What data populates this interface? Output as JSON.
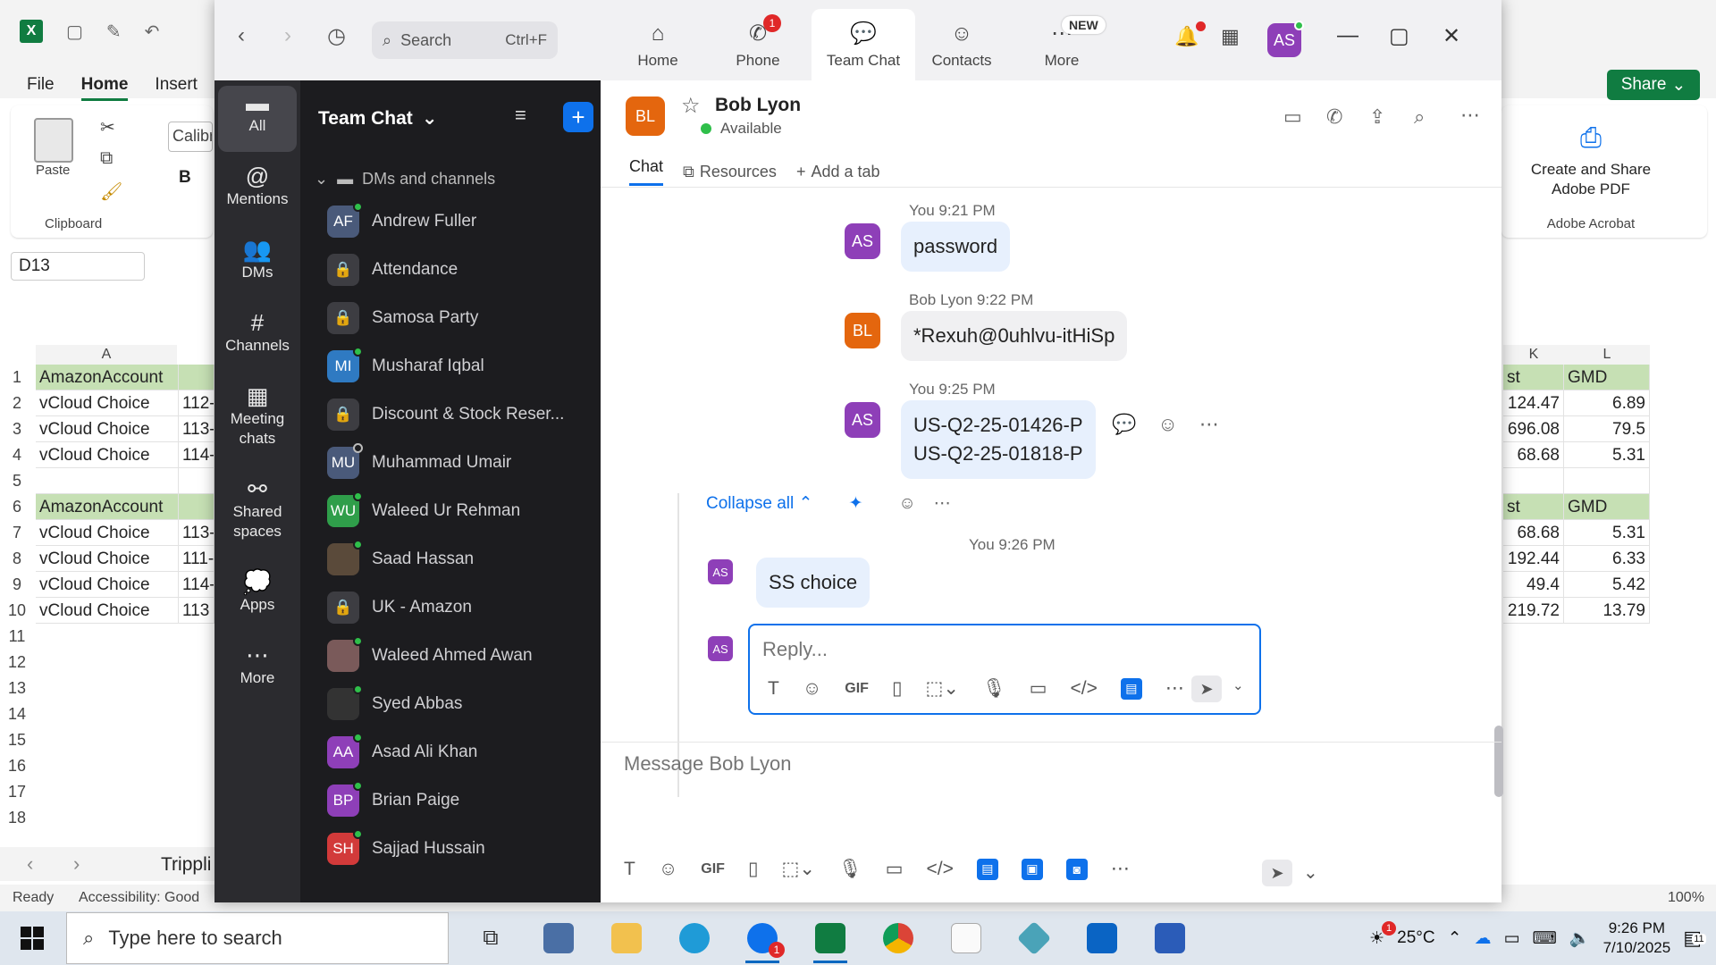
{
  "excel": {
    "tabs": [
      "File",
      "Home",
      "Insert"
    ],
    "active_tab": "Home",
    "clipboard": {
      "paste": "Paste",
      "group": "Clipboard"
    },
    "font_name": "Calibri",
    "bold": "B",
    "name_box": "D13",
    "share": "Share",
    "adobe": {
      "line1": "Create and Share",
      "line2": "Adobe PDF",
      "group": "Adobe Acrobat"
    },
    "col_a": "A",
    "col_k": "K",
    "col_l": "L",
    "rows": [
      "1",
      "2",
      "3",
      "4",
      "5",
      "6",
      "7",
      "8",
      "9",
      "10",
      "11",
      "12",
      "13",
      "14",
      "15",
      "16",
      "17",
      "18"
    ],
    "col_a_cells": [
      "AmazonAccount",
      "vCloud Choice",
      "vCloud Choice",
      "vCloud Choice",
      "",
      "AmazonAccount",
      "vCloud Choice",
      "vCloud Choice",
      "vCloud Choice",
      "vCloud Choice"
    ],
    "col_b_cells": [
      "",
      "112-",
      "113-",
      "114-",
      "",
      "",
      "113-",
      "111-",
      "114-",
      "113"
    ],
    "col_k_cells": [
      "st",
      "124.47",
      "696.08",
      "68.68",
      "",
      "st",
      "68.68",
      "192.44",
      "49.4",
      "219.72"
    ],
    "col_l_cells": [
      "GMD",
      "6.89",
      "79.5",
      "5.31",
      "",
      "GMD",
      "5.31",
      "6.33",
      "5.42",
      "13.79"
    ],
    "sheet_tab": "Trippli",
    "status_ready": "Ready",
    "status_access": "Accessibility: Good",
    "zoom": "100%"
  },
  "taskbar": {
    "search_placeholder": "Type here to search",
    "weather": "25°C",
    "time": "9:26 PM",
    "date": "7/10/2025",
    "notif_count": "11",
    "zoom_badge": "1",
    "weather_badge": "1"
  },
  "zoom": {
    "search": {
      "label": "Search",
      "shortcut": "Ctrl+F"
    },
    "tabs": [
      {
        "label": "Home"
      },
      {
        "label": "Phone",
        "badge": "1"
      },
      {
        "label": "Team Chat"
      },
      {
        "label": "Contacts"
      },
      {
        "label": "More",
        "badge": "NEW"
      }
    ],
    "user_initials": "AS",
    "rail": [
      {
        "label": "All"
      },
      {
        "label": "Mentions"
      },
      {
        "label": "DMs"
      },
      {
        "label": "Channels"
      },
      {
        "label": "Meeting chats"
      },
      {
        "label": "Shared spaces"
      },
      {
        "label": "Apps"
      },
      {
        "label": "More"
      }
    ],
    "side": {
      "title": "Team Chat",
      "section": "DMs and channels",
      "items": [
        {
          "name": "Andrew Fuller",
          "initials": "AF",
          "color": "#4a5a7a",
          "status": "green"
        },
        {
          "name": "Attendance",
          "initials": "",
          "color": "#3d3d42",
          "status": "lock"
        },
        {
          "name": "Samosa Party",
          "initials": "",
          "color": "#3d3d42",
          "status": "lock"
        },
        {
          "name": "Musharaf Iqbal",
          "initials": "MI",
          "color": "#2f7ac2",
          "status": "green"
        },
        {
          "name": "Discount & Stock Reser...",
          "initials": "",
          "color": "#3d3d42",
          "status": "lock"
        },
        {
          "name": "Muhammad Umair",
          "initials": "MU",
          "color": "#4a5a7a",
          "status": "grey"
        },
        {
          "name": "Waleed Ur Rehman",
          "initials": "WU",
          "color": "#2f9e4a",
          "status": "green"
        },
        {
          "name": "Saad Hassan",
          "initials": "",
          "color": "#5a4a3a",
          "status": "green"
        },
        {
          "name": "UK - Amazon",
          "initials": "",
          "color": "#3d3d42",
          "status": "lock"
        },
        {
          "name": "Waleed Ahmed Awan",
          "initials": "",
          "color": "#7a5a5a",
          "status": "green"
        },
        {
          "name": "Syed Abbas",
          "initials": "",
          "color": "#333",
          "status": "green"
        },
        {
          "name": "Asad Ali Khan",
          "initials": "AA",
          "color": "#8e3fb8",
          "status": "green"
        },
        {
          "name": "Brian Paige",
          "initials": "BP",
          "color": "#8e3fb8",
          "status": "green"
        },
        {
          "name": "Sajjad Hussain",
          "initials": "SH",
          "color": "#d23a3a",
          "status": "green"
        }
      ]
    },
    "chat": {
      "contact_initials": "BL",
      "contact_name": "Bob Lyon",
      "contact_status": "Available",
      "tabs": [
        "Chat",
        "Resources",
        "Add a tab"
      ],
      "messages": [
        {
          "meta": "You 9:21 PM",
          "initials": "AS",
          "text": "password"
        },
        {
          "meta": "Bob Lyon 9:22 PM",
          "initials": "BL",
          "text": "*Rexuh@0uhlvu-itHiSp"
        },
        {
          "meta": "You 9:25 PM",
          "initials": "AS",
          "line1": "US-Q2-25-01426-P",
          "line2": "US-Q2-25-01818-P"
        }
      ],
      "collapse": "Collapse all",
      "thread_reply": {
        "meta": "You 9:26 PM",
        "initials": "AS",
        "text": "SS choice"
      },
      "reply_placeholder": "Reply...",
      "compose_placeholder": "Message Bob Lyon",
      "gif": "GIF"
    }
  }
}
